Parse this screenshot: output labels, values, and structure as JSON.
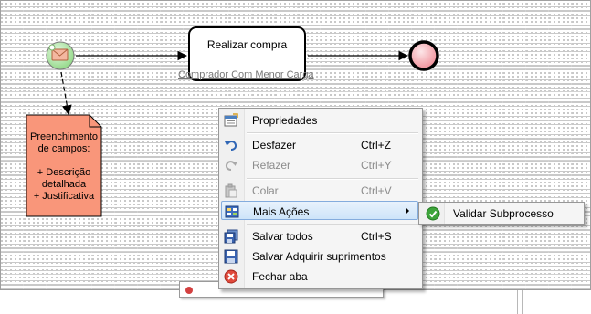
{
  "diagram": {
    "task": {
      "title": "Realizar compra",
      "performer": "Comprador Com Menor Carga"
    },
    "annotation": {
      "lines": [
        "Preenchimento",
        "de campos:",
        "",
        "+ Descrição",
        "detalhada",
        "+ Justificativa"
      ]
    }
  },
  "context_menu": {
    "items": [
      {
        "label": "Propriedades",
        "shortcut": "",
        "icon": "properties-icon",
        "enabled": true
      },
      {
        "label": "Desfazer",
        "shortcut": "Ctrl+Z",
        "icon": "undo-icon",
        "enabled": true
      },
      {
        "label": "Refazer",
        "shortcut": "Ctrl+Y",
        "icon": "redo-icon",
        "enabled": false
      },
      {
        "label": "Colar",
        "shortcut": "Ctrl+V",
        "icon": "paste-icon",
        "enabled": false
      },
      {
        "label": "Mais Ações",
        "shortcut": "",
        "icon": "more-actions-icon",
        "enabled": true,
        "highlighted": true,
        "has_submenu": true
      },
      {
        "label": "Salvar todos",
        "shortcut": "Ctrl+S",
        "icon": "save-all-icon",
        "enabled": true
      },
      {
        "label": "Salvar Adquirir suprimentos",
        "shortcut": "",
        "icon": "save-icon",
        "enabled": true
      },
      {
        "label": "Fechar aba",
        "shortcut": "",
        "icon": "close-tab-icon",
        "enabled": true
      }
    ]
  },
  "submenu": {
    "items": [
      {
        "label": "Validar Subprocesso",
        "icon": "validate-check-icon"
      }
    ]
  },
  "colors": {
    "start_event_fill": "#a9e5a0",
    "end_event_fill": "#f2a3ab",
    "annotation_fill": "#f9967a",
    "menu_highlight": "#cde4f9"
  }
}
